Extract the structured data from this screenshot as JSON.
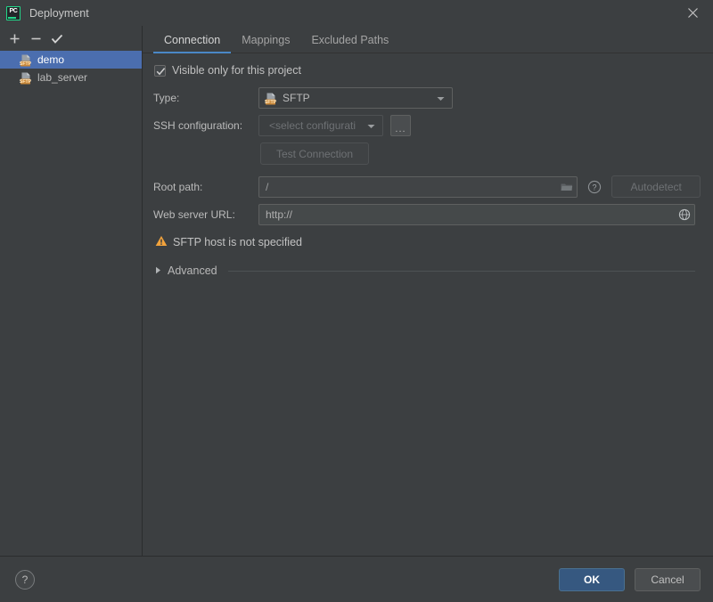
{
  "window": {
    "title": "Deployment",
    "logo_text": "PC",
    "close_icon": "close-icon"
  },
  "sidebar": {
    "toolbar": [
      {
        "name": "add-server-button",
        "icon": "plus-icon",
        "label": "+"
      },
      {
        "name": "remove-server-button",
        "icon": "minus-icon",
        "label": "−"
      },
      {
        "name": "set-default-server-button",
        "icon": "check-icon",
        "label": "✓"
      }
    ],
    "servers": [
      {
        "label": "demo",
        "icon": "sftp-server-icon",
        "selected": true
      },
      {
        "label": "lab_server",
        "icon": "sftp-server-icon",
        "selected": false
      }
    ]
  },
  "tabs": [
    {
      "label": "Connection",
      "active": true
    },
    {
      "label": "Mappings",
      "active": false
    },
    {
      "label": "Excluded Paths",
      "active": false
    }
  ],
  "connection": {
    "visible_only_checkbox": {
      "label": "Visible only for this project",
      "checked": true
    },
    "type": {
      "label": "Type:",
      "value": "SFTP",
      "icon": "sftp-server-icon",
      "dropdown_icon": "chevron-down-icon"
    },
    "ssh_configuration": {
      "label": "SSH configuration:",
      "value": "<select configurati",
      "placeholder": "<select configuration>",
      "dropdown_icon": "chevron-down-icon",
      "browse_button_label": "...",
      "disabled": true
    },
    "test_connection": {
      "label": "Test Connection",
      "disabled": true
    },
    "root_path": {
      "label": "Root path:",
      "value": "/",
      "browse_icon": "folder-icon",
      "help_icon": "help-circle-icon",
      "autodetect_label": "Autodetect",
      "autodetect_disabled": true
    },
    "web_server_url": {
      "label": "Web server URL:",
      "value": "http://",
      "open_icon": "globe-icon"
    },
    "warning": {
      "icon": "warning-triangle-icon",
      "text": "SFTP host is not specified",
      "color": "#f2a33c"
    },
    "advanced": {
      "label": "Advanced",
      "icon": "chevron-right-icon",
      "expanded": false
    }
  },
  "footer": {
    "help_label": "?",
    "ok_label": "OK",
    "cancel_label": "Cancel",
    "ok_color": "#365880"
  }
}
